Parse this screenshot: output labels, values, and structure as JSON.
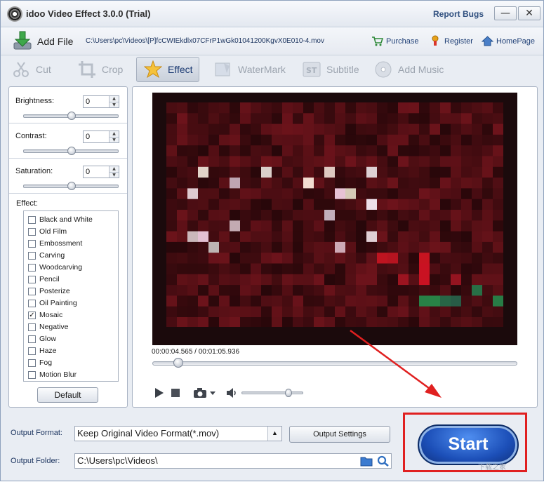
{
  "window": {
    "title": "idoo Video Effect 3.0.0 (Trial)",
    "report_bugs": "Report Bugs",
    "minimize": "—",
    "close": "✕"
  },
  "toolbar": {
    "add_file": "Add File",
    "file_path": "C:\\Users\\pc\\Videos\\[P]fcCWIEkdlx07CFrP1wGk01041200KgvX0E010-4.mov",
    "purchase": "Purchase",
    "register": "Register",
    "homepage": "HomePage"
  },
  "tabs": [
    {
      "label": "Cut",
      "icon": "scissors-icon",
      "active": false
    },
    {
      "label": "Crop",
      "icon": "crop-icon",
      "active": false
    },
    {
      "label": "Effect",
      "icon": "effect-star-icon",
      "active": true
    },
    {
      "label": "WaterMark",
      "icon": "watermark-icon",
      "active": false
    },
    {
      "label": "Subtitle",
      "icon": "subtitle-icon",
      "active": false
    },
    {
      "label": "Add Music",
      "icon": "music-disc-icon",
      "active": false
    }
  ],
  "adjustments": {
    "brightness": {
      "label": "Brightness:",
      "value": "0"
    },
    "contrast": {
      "label": "Contrast:",
      "value": "0"
    },
    "saturation": {
      "label": "Saturation:",
      "value": "0"
    }
  },
  "effects": {
    "label": "Effect:",
    "items": [
      {
        "label": "Black and White",
        "checked": false
      },
      {
        "label": "Old Film",
        "checked": false
      },
      {
        "label": "Embossment",
        "checked": false
      },
      {
        "label": "Carving",
        "checked": false
      },
      {
        "label": "Woodcarving",
        "checked": false
      },
      {
        "label": "Pencil",
        "checked": false
      },
      {
        "label": "Posterize",
        "checked": false
      },
      {
        "label": "Oil Painting",
        "checked": false
      },
      {
        "label": "Mosaic",
        "checked": true
      },
      {
        "label": "Negative",
        "checked": false
      },
      {
        "label": "Glow",
        "checked": false
      },
      {
        "label": "Haze",
        "checked": false
      },
      {
        "label": "Fog",
        "checked": false
      },
      {
        "label": "Motion Blur",
        "checked": false
      }
    ],
    "default_button": "Default"
  },
  "player": {
    "timecode": "00:00:04.565 / 00:01:05.936",
    "position_fraction": 0.069,
    "volume_fraction": 0.75
  },
  "output": {
    "format_label": "Output Format:",
    "format_value": "Keep Original Video Format(*.mov)",
    "settings_button": "Output Settings",
    "folder_label": "Output Folder:",
    "folder_value": "C:\\Users\\pc\\Videos\\",
    "start_button": "Start"
  },
  "colors": {
    "accent_blue": "#1c4fb8",
    "highlight_red": "#e02020",
    "link_blue": "#1f3f76"
  },
  "watermark": "下载之家"
}
